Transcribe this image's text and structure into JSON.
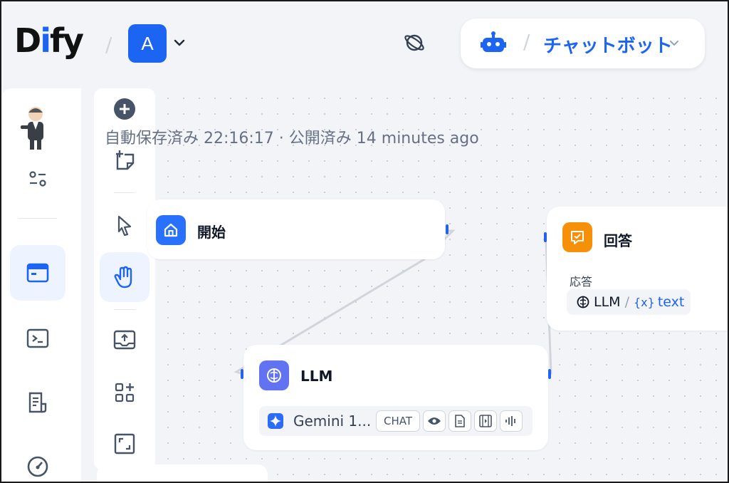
{
  "header": {
    "logo_text_d": "D",
    "logo_text_i": "i",
    "logo_text_fy": "fy",
    "separator": "/",
    "app_initial": "A",
    "mode_label": "チャットボット"
  },
  "sidebar": {
    "items": [
      "settings-sliders-icon",
      "app-window-icon",
      "terminal-icon",
      "document-icon",
      "gauge-icon"
    ]
  },
  "toolbar": {
    "tools": [
      "add",
      "note",
      "pointer",
      "hand",
      "export",
      "organize",
      "fit"
    ]
  },
  "autosave_text": "自動保存済み 22:16:17 · 公開済み 14 minutes ago",
  "nodes": {
    "start": {
      "title": "開始"
    },
    "answer": {
      "title": "回答",
      "response_label": "応答",
      "var_source": "LLM",
      "var_sep": "/",
      "var_symbol": "{x}",
      "var_name": "text"
    },
    "llm": {
      "title": "LLM",
      "model_name": "Gemini 1...",
      "badge_chat": "CHAT"
    }
  },
  "colors": {
    "accent": "#1c64f2",
    "answer_icon": "#f79009",
    "llm_icon": "#6172f3"
  }
}
